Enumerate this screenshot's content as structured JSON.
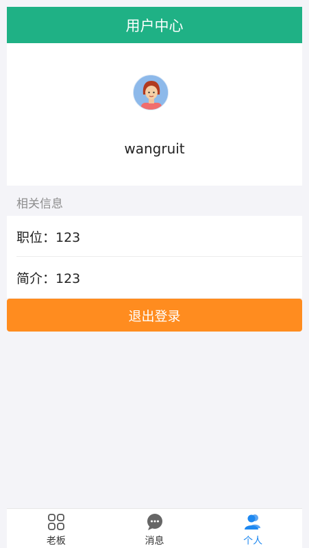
{
  "header": {
    "title": "用户中心"
  },
  "profile": {
    "username": "wangruit"
  },
  "info_section": {
    "label": "相关信息",
    "rows": [
      {
        "text": "职位：123"
      },
      {
        "text": "简介：123"
      }
    ]
  },
  "logout_label": "退出登录",
  "tabbar": {
    "tabs": [
      {
        "label": "老板",
        "icon": "grid-icon",
        "active": false
      },
      {
        "label": "消息",
        "icon": "chat-bubble-icon",
        "active": false
      },
      {
        "label": "个人",
        "icon": "user-icon",
        "active": true
      }
    ]
  },
  "colors": {
    "header_bg": "#1fb185",
    "logout_bg": "#ff8c1f",
    "active_tab": "#1e88f0"
  }
}
